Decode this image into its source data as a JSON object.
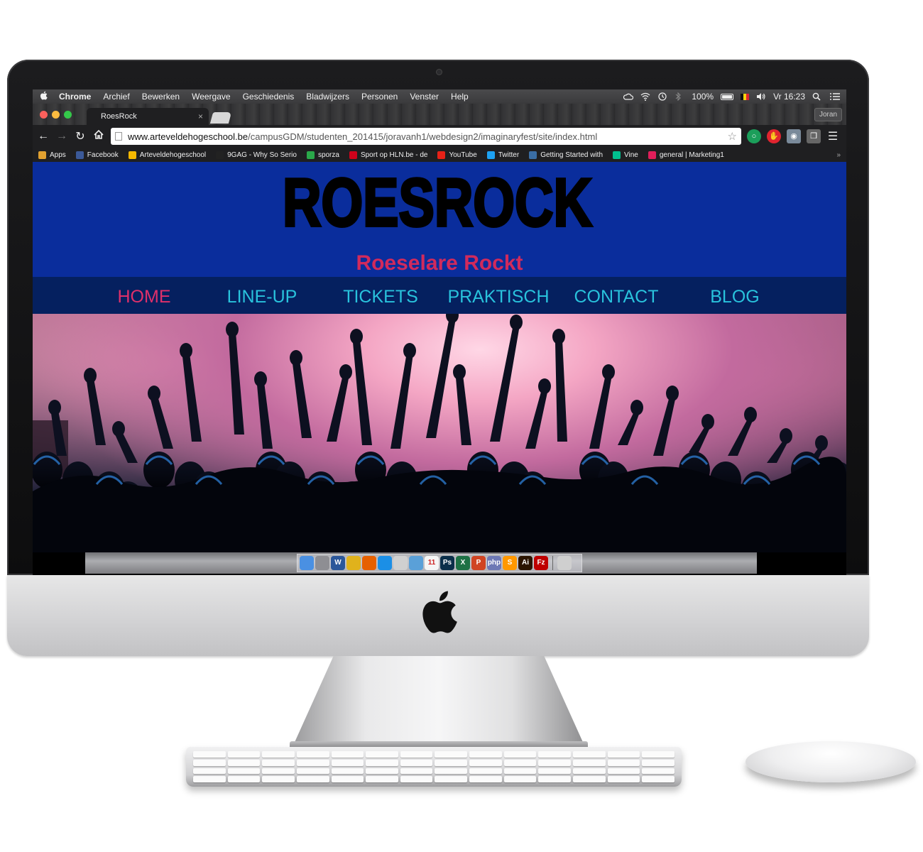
{
  "menubar": {
    "apple_label": "",
    "app_name": "Chrome",
    "items": [
      "Archief",
      "Bewerken",
      "Weergave",
      "Geschiedenis",
      "Bladwijzers",
      "Personen",
      "Venster",
      "Help"
    ],
    "battery": "100%",
    "clock": "Vr 16:23"
  },
  "browser": {
    "tab_title": "RoesRock",
    "tab_close": "×",
    "profile_name": "Joran",
    "url_host": "www.arteveldehogeschool.be",
    "url_path": "/campusGDM/studenten_201415/joravanh1/webdesign2/imaginaryfest/site/index.html"
  },
  "bookmarks": [
    {
      "label": "Apps",
      "color": "#e0a030"
    },
    {
      "label": "Facebook",
      "color": "#3b5998"
    },
    {
      "label": "Arteveldehogeschool",
      "color": "#f5b800"
    },
    {
      "label": "9GAG - Why So Serio",
      "color": "#222222"
    },
    {
      "label": "sporza",
      "color": "#2aa84a"
    },
    {
      "label": "Sport op HLN.be - de",
      "color": "#d0021b"
    },
    {
      "label": "YouTube",
      "color": "#e62117"
    },
    {
      "label": "Twitter",
      "color": "#1da1f2"
    },
    {
      "label": "Getting Started with",
      "color": "#3a6ea5"
    },
    {
      "label": "Vine",
      "color": "#00bf8f"
    },
    {
      "label": "general | Marketing1",
      "color": "#e01e5a"
    }
  ],
  "site": {
    "logo_text": "ROESROCK",
    "tagline": "Roeselare Rockt",
    "nav": [
      {
        "label": "HOME",
        "active": true
      },
      {
        "label": "LINE-UP",
        "active": false
      },
      {
        "label": "TICKETS",
        "active": false
      },
      {
        "label": "PRAKTISCH",
        "active": false
      },
      {
        "label": "CONTACT",
        "active": false
      },
      {
        "label": "BLOG",
        "active": false
      }
    ]
  },
  "dock": [
    {
      "name": "finder-icon",
      "label": "",
      "color": "#4a90e2"
    },
    {
      "name": "launchpad-icon",
      "label": "",
      "color": "#8e8e93"
    },
    {
      "name": "word-icon",
      "label": "W",
      "color": "#2b579a"
    },
    {
      "name": "chrome-icon",
      "label": "",
      "color": "#e0b21c"
    },
    {
      "name": "firefox-icon",
      "label": "",
      "color": "#e66000"
    },
    {
      "name": "safari-icon",
      "label": "",
      "color": "#1b8fe6"
    },
    {
      "name": "calculator-icon",
      "label": "",
      "color": "#d0d0d0"
    },
    {
      "name": "preview-icon",
      "label": "",
      "color": "#5aa0d8"
    },
    {
      "name": "calendar-icon",
      "label": "11",
      "color": "#f5f5f5"
    },
    {
      "name": "photoshop-icon",
      "label": "Ps",
      "color": "#0b2f4a"
    },
    {
      "name": "excel-icon",
      "label": "X",
      "color": "#1e7145"
    },
    {
      "name": "powerpoint-icon",
      "label": "P",
      "color": "#d04423"
    },
    {
      "name": "php-icon",
      "label": "php",
      "color": "#6d78b5"
    },
    {
      "name": "sublime-icon",
      "label": "S",
      "color": "#ff9800"
    },
    {
      "name": "illustrator-icon",
      "label": "Ai",
      "color": "#2b1400"
    },
    {
      "name": "filezilla-icon",
      "label": "Fz",
      "color": "#bf0000"
    },
    {
      "name": "trash-icon",
      "label": "",
      "color": "#cfcfcf"
    }
  ],
  "colors": {
    "header_blue": "#0a2d9c",
    "nav_navy": "#05205f",
    "nav_link": "#29c2dc",
    "accent_pink": "#e0306a"
  }
}
